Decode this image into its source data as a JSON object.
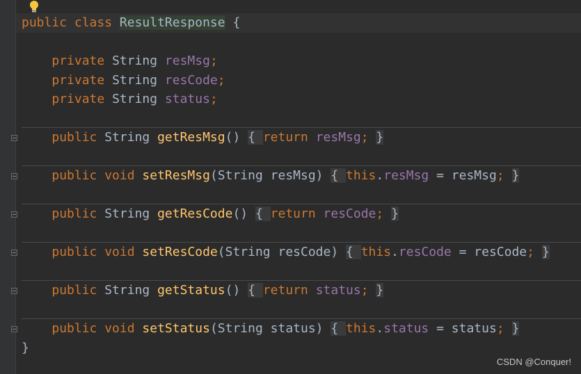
{
  "editor": {
    "lines": [
      {
        "tokens": [
          {
            "t": "public ",
            "c": "kw"
          },
          {
            "t": "class ",
            "c": "kw"
          },
          {
            "t": "ResultResponse",
            "c": "classname"
          },
          {
            "t": " {",
            "c": ""
          }
        ]
      },
      {
        "tokens": []
      },
      {
        "tokens": [
          {
            "t": "    ",
            "c": ""
          },
          {
            "t": "private ",
            "c": "kw"
          },
          {
            "t": "String ",
            "c": "type"
          },
          {
            "t": "resMsg",
            "c": "field"
          },
          {
            "t": ";",
            "c": "kw"
          }
        ]
      },
      {
        "tokens": [
          {
            "t": "    ",
            "c": ""
          },
          {
            "t": "private ",
            "c": "kw"
          },
          {
            "t": "String ",
            "c": "type"
          },
          {
            "t": "resCode",
            "c": "field"
          },
          {
            "t": ";",
            "c": "kw"
          }
        ]
      },
      {
        "tokens": [
          {
            "t": "    ",
            "c": ""
          },
          {
            "t": "private ",
            "c": "kw"
          },
          {
            "t": "String ",
            "c": "type"
          },
          {
            "t": "status",
            "c": "field"
          },
          {
            "t": ";",
            "c": "kw"
          }
        ]
      },
      {
        "tokens": []
      },
      {
        "tokens": [
          {
            "t": "    ",
            "c": ""
          },
          {
            "t": "public ",
            "c": "kw"
          },
          {
            "t": "String ",
            "c": "type"
          },
          {
            "t": "getResMsg",
            "c": "method"
          },
          {
            "t": "() ",
            "c": ""
          },
          {
            "t": "{ ",
            "c": "fold-bg"
          },
          {
            "t": "return ",
            "c": "kw"
          },
          {
            "t": "resMsg",
            "c": "field"
          },
          {
            "t": "; ",
            "c": "kw"
          },
          {
            "t": "}",
            "c": "fold-bg"
          }
        ]
      },
      {
        "tokens": []
      },
      {
        "tokens": [
          {
            "t": "    ",
            "c": ""
          },
          {
            "t": "public ",
            "c": "kw"
          },
          {
            "t": "void ",
            "c": "kw"
          },
          {
            "t": "setResMsg",
            "c": "method"
          },
          {
            "t": "(String resMsg) ",
            "c": ""
          },
          {
            "t": "{ ",
            "c": "fold-bg"
          },
          {
            "t": "this",
            "c": "kw"
          },
          {
            "t": ".",
            "c": ""
          },
          {
            "t": "resMsg",
            "c": "field"
          },
          {
            "t": " = resMsg",
            "c": ""
          },
          {
            "t": "; ",
            "c": "kw"
          },
          {
            "t": "}",
            "c": "fold-bg"
          }
        ]
      },
      {
        "tokens": []
      },
      {
        "tokens": [
          {
            "t": "    ",
            "c": ""
          },
          {
            "t": "public ",
            "c": "kw"
          },
          {
            "t": "String ",
            "c": "type"
          },
          {
            "t": "getResCode",
            "c": "method"
          },
          {
            "t": "() ",
            "c": ""
          },
          {
            "t": "{ ",
            "c": "fold-bg"
          },
          {
            "t": "return ",
            "c": "kw"
          },
          {
            "t": "resCode",
            "c": "field"
          },
          {
            "t": "; ",
            "c": "kw"
          },
          {
            "t": "}",
            "c": "fold-bg"
          }
        ]
      },
      {
        "tokens": []
      },
      {
        "tokens": [
          {
            "t": "    ",
            "c": ""
          },
          {
            "t": "public ",
            "c": "kw"
          },
          {
            "t": "void ",
            "c": "kw"
          },
          {
            "t": "setResCode",
            "c": "method"
          },
          {
            "t": "(String resCode) ",
            "c": ""
          },
          {
            "t": "{ ",
            "c": "fold-bg"
          },
          {
            "t": "this",
            "c": "kw"
          },
          {
            "t": ".",
            "c": ""
          },
          {
            "t": "resCode",
            "c": "field"
          },
          {
            "t": " = resCode",
            "c": ""
          },
          {
            "t": "; ",
            "c": "kw"
          },
          {
            "t": "}",
            "c": "fold-bg"
          }
        ]
      },
      {
        "tokens": []
      },
      {
        "tokens": [
          {
            "t": "    ",
            "c": ""
          },
          {
            "t": "public ",
            "c": "kw"
          },
          {
            "t": "String ",
            "c": "type"
          },
          {
            "t": "getStatus",
            "c": "method"
          },
          {
            "t": "() ",
            "c": ""
          },
          {
            "t": "{ ",
            "c": "fold-bg"
          },
          {
            "t": "return ",
            "c": "kw"
          },
          {
            "t": "status",
            "c": "field"
          },
          {
            "t": "; ",
            "c": "kw"
          },
          {
            "t": "}",
            "c": "fold-bg"
          }
        ]
      },
      {
        "tokens": []
      },
      {
        "tokens": [
          {
            "t": "    ",
            "c": ""
          },
          {
            "t": "public ",
            "c": "kw"
          },
          {
            "t": "void ",
            "c": "kw"
          },
          {
            "t": "setStatus",
            "c": "method"
          },
          {
            "t": "(String status) ",
            "c": ""
          },
          {
            "t": "{ ",
            "c": "fold-bg"
          },
          {
            "t": "this",
            "c": "kw"
          },
          {
            "t": ".",
            "c": ""
          },
          {
            "t": "status",
            "c": "field"
          },
          {
            "t": " = status",
            "c": ""
          },
          {
            "t": "; ",
            "c": "kw"
          },
          {
            "t": "}",
            "c": "fold-bg"
          }
        ]
      },
      {
        "tokens": [
          {
            "t": "}",
            "c": ""
          }
        ]
      }
    ],
    "icons": {
      "intention": "lightbulb-icon",
      "fold": "fold-toggle-icon"
    },
    "colors": {
      "background": "#2b2b2b",
      "keyword": "#cc7832",
      "field": "#9876aa",
      "method": "#ffc66d",
      "text": "#a9b7c6"
    }
  },
  "watermark": "CSDN @Conquer!"
}
